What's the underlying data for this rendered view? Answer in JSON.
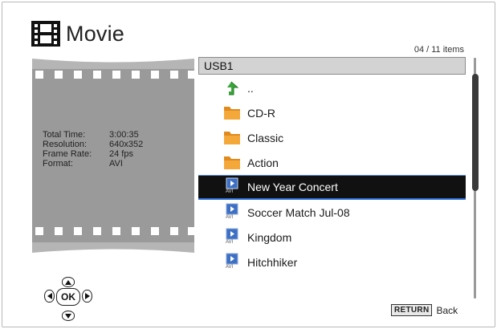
{
  "header": {
    "title": "Movie",
    "icon": "film-icon"
  },
  "counter": "04 / 11 items",
  "preview": {
    "info": [
      {
        "label": "Total Time:",
        "value": "3:00:35"
      },
      {
        "label": "Resolution:",
        "value": "640x352"
      },
      {
        "label": "Frame Rate:",
        "value": "24 fps"
      },
      {
        "label": "Format:",
        "value": "AVI"
      }
    ]
  },
  "path": "USB1",
  "files": [
    {
      "label": "..",
      "icon": "up-arrow-icon"
    },
    {
      "label": "CD-R",
      "icon": "folder-icon"
    },
    {
      "label": "Classic",
      "icon": "folder-icon"
    },
    {
      "label": "Action",
      "icon": "folder-icon"
    },
    {
      "label": "New Year Concert",
      "icon": "avi-file-icon",
      "selected": true
    },
    {
      "label": "Soccer Match Jul-08",
      "icon": "avi-file-icon"
    },
    {
      "label": "Kingdom",
      "icon": "avi-file-icon"
    },
    {
      "label": "Hitchhiker",
      "icon": "avi-file-icon"
    }
  ],
  "file_icon_caption": "AVI",
  "dpad": {
    "ok_label": "OK"
  },
  "footer": {
    "return_key": "RETURN",
    "return_label": "Back"
  },
  "colors": {
    "selection_bg": "#111111",
    "selection_border": "#2d6fd9",
    "folder": "#f0a030",
    "up_arrow": "#3aa53a"
  }
}
